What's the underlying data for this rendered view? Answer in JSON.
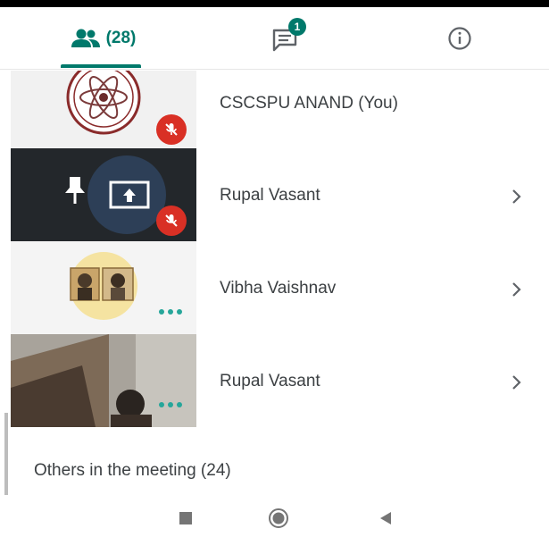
{
  "tabs": {
    "people_count": "(28)",
    "chat_badge": "1"
  },
  "participants": [
    {
      "name": "CSCSPU ANAND (You)",
      "muted": true
    },
    {
      "name": "Rupal Vasant",
      "muted": true,
      "presenting": true
    },
    {
      "name": "Vibha Vaishnav",
      "muted": false
    },
    {
      "name": "Rupal Vasant",
      "muted": false
    }
  ],
  "others": {
    "label": "Others in the meeting (24)"
  },
  "colors": {
    "accent": "#00796b",
    "mute": "#d93025",
    "dots": "#26a69a"
  },
  "icons": [
    "people-icon",
    "chat-icon",
    "info-icon",
    "chevron-right-icon",
    "mic-off-icon",
    "pin-icon",
    "present-screen-icon",
    "more-dots-icon",
    "stop-square-icon",
    "home-circle-icon",
    "back-triangle-icon"
  ]
}
